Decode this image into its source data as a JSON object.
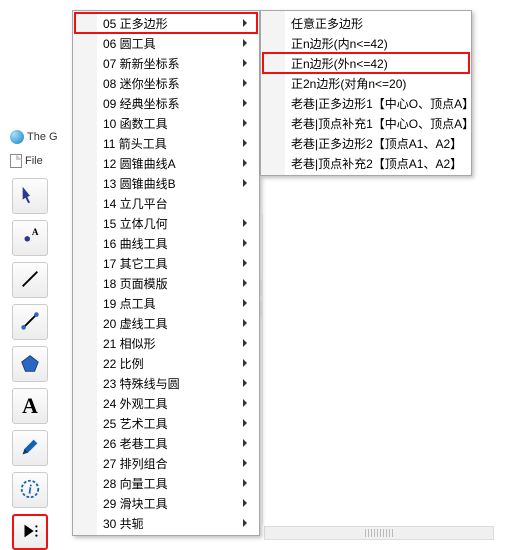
{
  "window": {
    "title_fragment_top": "The G",
    "title_fragment_bottom": "File"
  },
  "toolbar": [
    {
      "name": "move-tool",
      "icon": "arrow",
      "highlighted": false
    },
    {
      "name": "point-tool",
      "icon": "dot-a",
      "highlighted": false
    },
    {
      "name": "line-tool",
      "icon": "line",
      "highlighted": false
    },
    {
      "name": "segment-tool",
      "icon": "segment",
      "highlighted": false
    },
    {
      "name": "polygon-tool",
      "icon": "polygon",
      "highlighted": false
    },
    {
      "name": "text-tool",
      "icon": "letter-a",
      "highlighted": false
    },
    {
      "name": "pen-tool",
      "icon": "pen",
      "highlighted": false
    },
    {
      "name": "info-tool",
      "icon": "info",
      "highlighted": false
    },
    {
      "name": "play-tool",
      "icon": "play",
      "highlighted": true
    }
  ],
  "primary_menu": [
    {
      "label": "05 正多边形",
      "has_sub": true,
      "highlighted": true
    },
    {
      "label": "06 圆工具",
      "has_sub": true,
      "highlighted": false
    },
    {
      "label": "07 新新坐标系",
      "has_sub": true,
      "highlighted": false
    },
    {
      "label": "08 迷你坐标系",
      "has_sub": true,
      "highlighted": false
    },
    {
      "label": "09 经典坐标系",
      "has_sub": true,
      "highlighted": false
    },
    {
      "label": "10 函数工具",
      "has_sub": true,
      "highlighted": false
    },
    {
      "label": "11 箭头工具",
      "has_sub": true,
      "highlighted": false
    },
    {
      "label": "12 圆锥曲线A",
      "has_sub": true,
      "highlighted": false
    },
    {
      "label": "13 圆锥曲线B",
      "has_sub": true,
      "highlighted": false
    },
    {
      "label": "14 立几平台",
      "has_sub": false,
      "highlighted": false
    },
    {
      "label": "15 立体几何",
      "has_sub": true,
      "highlighted": false
    },
    {
      "label": "16 曲线工具",
      "has_sub": true,
      "highlighted": false
    },
    {
      "label": "17 其它工具",
      "has_sub": true,
      "highlighted": false
    },
    {
      "label": "18 页面模版",
      "has_sub": true,
      "highlighted": false
    },
    {
      "label": "19 点工具",
      "has_sub": true,
      "highlighted": false
    },
    {
      "label": "20 虚线工具",
      "has_sub": true,
      "highlighted": false
    },
    {
      "label": "21 相似形",
      "has_sub": true,
      "highlighted": false
    },
    {
      "label": "22 比例",
      "has_sub": true,
      "highlighted": false
    },
    {
      "label": "23 特殊线与圆",
      "has_sub": true,
      "highlighted": false
    },
    {
      "label": "24 外观工具",
      "has_sub": true,
      "highlighted": false
    },
    {
      "label": "25 艺术工具",
      "has_sub": true,
      "highlighted": false
    },
    {
      "label": "26 老巷工具",
      "has_sub": true,
      "highlighted": false
    },
    {
      "label": "27 排列组合",
      "has_sub": true,
      "highlighted": false
    },
    {
      "label": "28 向量工具",
      "has_sub": true,
      "highlighted": false
    },
    {
      "label": "29 滑块工具",
      "has_sub": true,
      "highlighted": false
    },
    {
      "label": "30 共轭",
      "has_sub": true,
      "highlighted": false
    }
  ],
  "secondary_menu": [
    {
      "label": "任意正多边形",
      "highlighted": false
    },
    {
      "label": "正n边形(内n<=42)",
      "highlighted": false
    },
    {
      "label": "正n边形(外n<=42)",
      "highlighted": true
    },
    {
      "label": "正2n边形(对角n<=20)",
      "highlighted": false
    },
    {
      "label": "老巷|正多边形1【中心O、顶点A】",
      "highlighted": false
    },
    {
      "label": "老巷|顶点补充1【中心O、顶点A】",
      "highlighted": false
    },
    {
      "label": "老巷|正多边形2【顶点A1、A2】",
      "highlighted": false
    },
    {
      "label": "老巷|顶点补充2【顶点A1、A2】",
      "highlighted": false
    }
  ]
}
